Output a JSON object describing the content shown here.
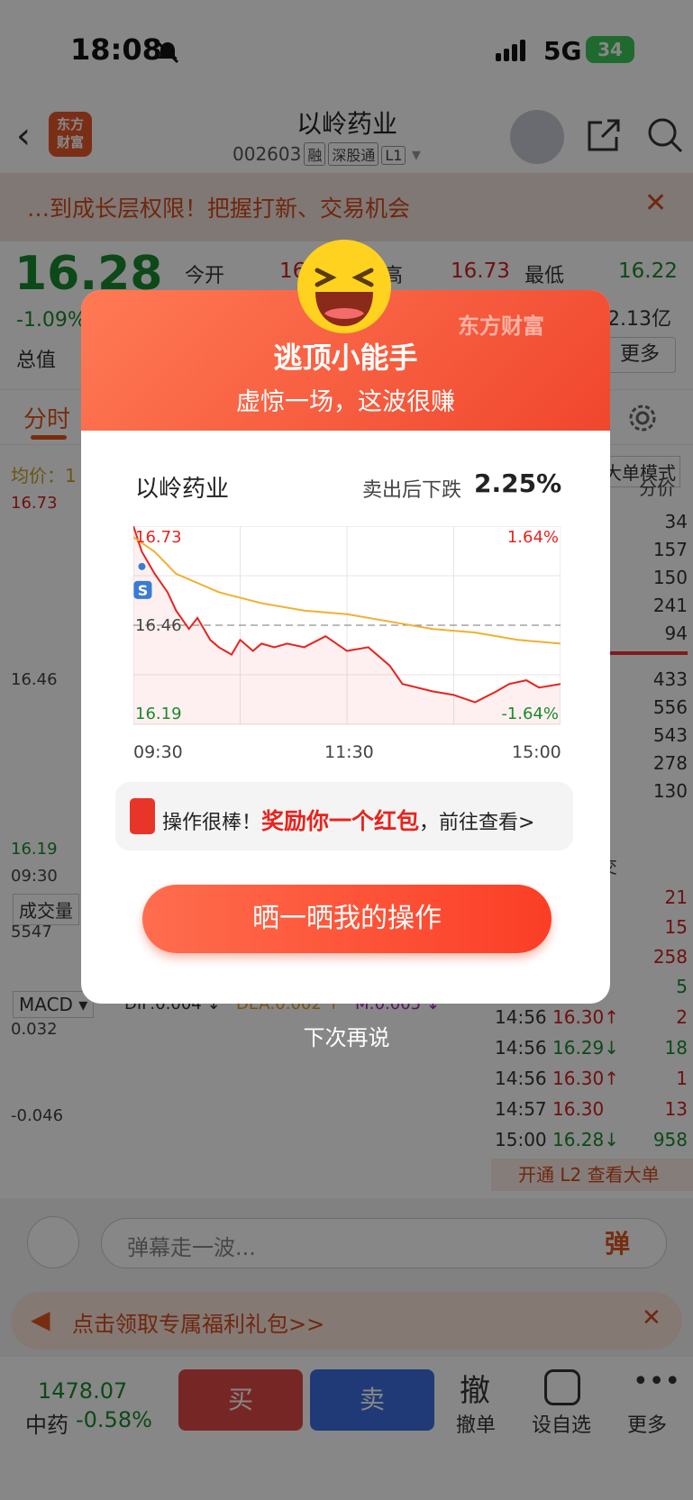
{
  "status": {
    "time": "18:08",
    "network": "5G",
    "battery": "34"
  },
  "nav": {
    "title": "以岭药业",
    "code": "002603",
    "tags": [
      "融",
      "深股通",
      "L1"
    ],
    "logo_line1": "东方",
    "logo_line2": "财富"
  },
  "banner": {
    "text": "…到成长层权限！把握打新、交易机会"
  },
  "quote": {
    "price": "16.28",
    "change": "-1.09%",
    "open_label": "今开",
    "open_partial": "16",
    "high_label_partial": "高",
    "high": "16.73",
    "low_label": "最低",
    "low": "16.22",
    "turnover_partial": "2.13亿",
    "total_label": "总值",
    "more": "更多"
  },
  "tabs": {
    "active": "分时"
  },
  "chart_bg": {
    "avg_label": "均价：1",
    "top": "16.73",
    "mid": "16.46",
    "bottom": "16.19",
    "time_start": "09:30",
    "volume_label": "成交量",
    "volume_max": "5547",
    "macd_label": "MACD",
    "dif": "DIF:0.004 ↓",
    "dea": "DEA:0.002 ↑",
    "m": "M:0.005 ↓",
    "macd_top": "0.032",
    "macd_bottom": "-0.046"
  },
  "right_panel": {
    "mode": "大单模式",
    "col": "分价",
    "vols": [
      "34",
      "157",
      "150",
      "241",
      "94",
      "433",
      "556",
      "543",
      "278",
      "130"
    ],
    "trade_header": "交",
    "trade_vols": [
      "21",
      "15",
      "258",
      "5"
    ],
    "trades": [
      {
        "t": "14:56",
        "p": "16.30↑",
        "v": "2"
      },
      {
        "t": "14:56",
        "p": "16.29↓",
        "v": "18"
      },
      {
        "t": "14:56",
        "p": "16.30↑",
        "v": "1"
      },
      {
        "t": "14:57",
        "p": "16.30",
        "v": "13"
      },
      {
        "t": "15:00",
        "p": "16.28↓",
        "v": "958"
      }
    ],
    "l2": "开通 L2 查看大单"
  },
  "danmaku": {
    "placeholder": "弹幕走一波...",
    "btn": "弹"
  },
  "gift": {
    "text": "点击领取专属福利礼包>>"
  },
  "bottom": {
    "index": "1478.07",
    "sector": "中药",
    "sector_chg": "-0.58%",
    "buy": "买",
    "sell": "卖",
    "cancel_icon": "撤",
    "cancel": "撤单",
    "watch": "设自选",
    "more": "更多"
  },
  "modal": {
    "title": "逃顶小能手",
    "subtitle": "虚惊一场，这波很赚",
    "brand": "东方财富",
    "stock": "以岭药业",
    "fall_label": "卖出后下跌",
    "fall_pct": "2.25%",
    "reward_prefix": "操作很棒！",
    "reward_red": "奖励你一个红包",
    "reward_suffix": "，前往查看>",
    "share_btn": "晒一晒我的操作",
    "skip": "下次再说"
  },
  "chart_data": {
    "type": "line",
    "x_ticks": [
      "09:30",
      "11:30",
      "15:00"
    ],
    "ylim": [
      16.19,
      16.73
    ],
    "y_labels": {
      "top": "16.73",
      "mid": "16.46",
      "bottom": "16.19"
    },
    "pct_labels": {
      "top": "1.64%",
      "bottom": "-1.64%"
    },
    "sell_marker": {
      "label": "S",
      "x": 0.02,
      "y": 16.62
    },
    "series": [
      {
        "values": [
          [
            0,
            16.73
          ],
          [
            0.02,
            16.66
          ],
          [
            0.05,
            16.6
          ],
          [
            0.08,
            16.55
          ],
          [
            0.1,
            16.5
          ],
          [
            0.13,
            16.45
          ],
          [
            0.15,
            16.48
          ],
          [
            0.18,
            16.42
          ],
          [
            0.2,
            16.4
          ],
          [
            0.23,
            16.38
          ],
          [
            0.25,
            16.42
          ],
          [
            0.28,
            16.39
          ],
          [
            0.3,
            16.41
          ],
          [
            0.33,
            16.4
          ],
          [
            0.36,
            16.41
          ],
          [
            0.4,
            16.4
          ],
          [
            0.45,
            16.43
          ],
          [
            0.5,
            16.39
          ],
          [
            0.55,
            16.4
          ],
          [
            0.6,
            16.35
          ],
          [
            0.63,
            16.3
          ],
          [
            0.7,
            16.28
          ],
          [
            0.75,
            16.27
          ],
          [
            0.8,
            16.25
          ],
          [
            0.85,
            16.28
          ],
          [
            0.88,
            16.3
          ],
          [
            0.92,
            16.31
          ],
          [
            0.95,
            16.29
          ],
          [
            1,
            16.3
          ]
        ]
      },
      {
        "values": [
          [
            0,
            16.7
          ],
          [
            0.05,
            16.66
          ],
          [
            0.1,
            16.6
          ],
          [
            0.2,
            16.55
          ],
          [
            0.3,
            16.52
          ],
          [
            0.4,
            16.5
          ],
          [
            0.5,
            16.49
          ],
          [
            0.6,
            16.47
          ],
          [
            0.7,
            16.45
          ],
          [
            0.8,
            16.44
          ],
          [
            0.9,
            16.42
          ],
          [
            1,
            16.41
          ]
        ]
      }
    ]
  }
}
